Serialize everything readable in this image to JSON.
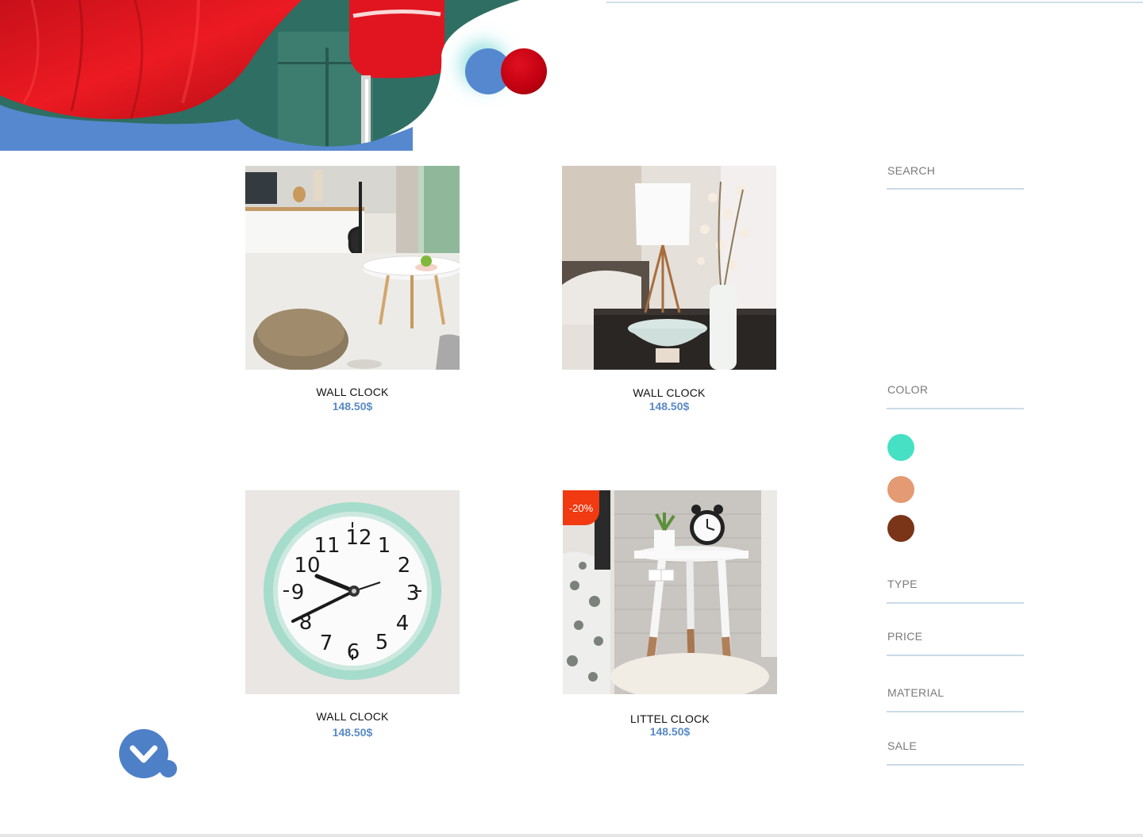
{
  "products": [
    {
      "name": "WALL CLOCK",
      "price": "148.50$",
      "image": "living-room-pouf-table"
    },
    {
      "name": "WALL CLOCK",
      "price": "148.50$",
      "image": "bedside-lamp-vase"
    },
    {
      "name": "WALL CLOCK",
      "price": "148.50$",
      "image": "mint-wall-clock"
    },
    {
      "name": "LITTEL CLOCK",
      "price": "148.50$",
      "image": "alarm-clock-side-table",
      "badge": "-20%"
    }
  ],
  "sidebar": {
    "search_label": "SEARCH",
    "color_label": "COLOR",
    "colors": [
      "#46e0c4",
      "#e49a72",
      "#7a3418"
    ],
    "type_label": "TYPE",
    "price_label": "PRICE",
    "material_label": "MATERIAL",
    "sale_label": "SALE"
  },
  "theme": {
    "accent": "#5a8ac6",
    "sale": "#f13a12",
    "hero_red": "#e8141e"
  }
}
